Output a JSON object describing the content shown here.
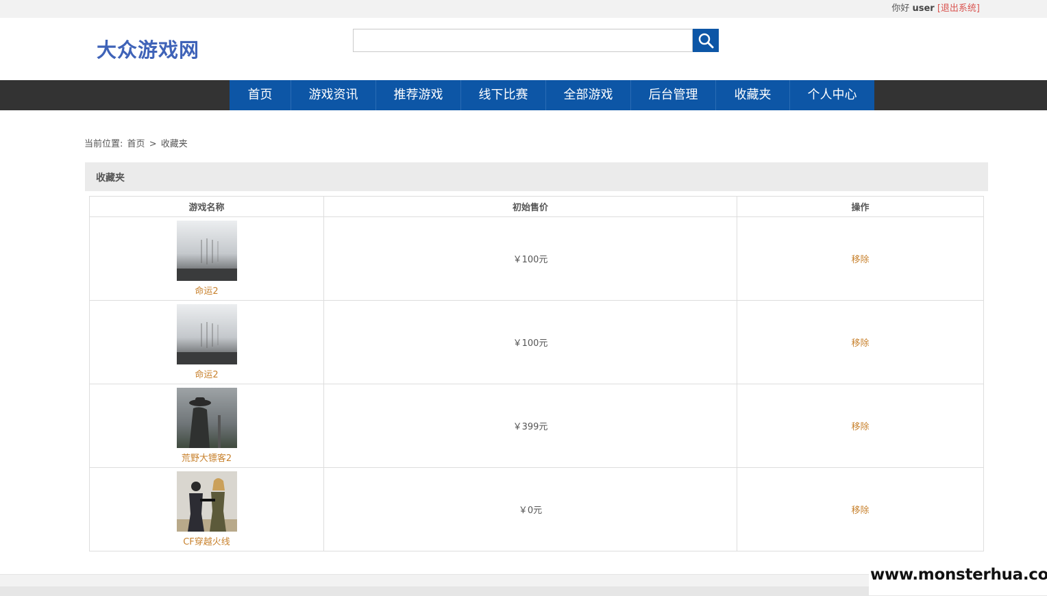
{
  "topbar": {
    "greeting": "你好",
    "username": "user",
    "logout": "[退出系统]"
  },
  "header": {
    "logo": "大众游戏网",
    "search": {
      "value": "",
      "placeholder": ""
    }
  },
  "nav": {
    "items": [
      {
        "label": "首页"
      },
      {
        "label": "游戏资讯"
      },
      {
        "label": "推荐游戏"
      },
      {
        "label": "线下比赛"
      },
      {
        "label": "全部游戏"
      },
      {
        "label": "后台管理"
      },
      {
        "label": "收藏夹"
      },
      {
        "label": "个人中心"
      }
    ]
  },
  "breadcrumb": {
    "prefix": "当前位置:",
    "home": "首页",
    "separator": ">",
    "current": "收藏夹"
  },
  "panel": {
    "title": "收藏夹"
  },
  "table": {
    "headers": [
      "游戏名称",
      "初始售价",
      "操作"
    ],
    "rows": [
      {
        "name": "命运2",
        "price": "￥100元",
        "action": "移除"
      },
      {
        "name": "命运2",
        "price": "￥100元",
        "action": "移除"
      },
      {
        "name": "荒野大镖客2",
        "price": "￥399元",
        "action": "移除"
      },
      {
        "name": "CF穿越火线",
        "price": "￥0元",
        "action": "移除"
      }
    ]
  },
  "watermark": "www.monsterhua.com",
  "colors": {
    "nav_blue": "#0d56a6",
    "nav_bar": "#333333",
    "link_orange": "#c8822e",
    "logo_blue": "#3f63b8",
    "logout_red": "#d9534f"
  }
}
